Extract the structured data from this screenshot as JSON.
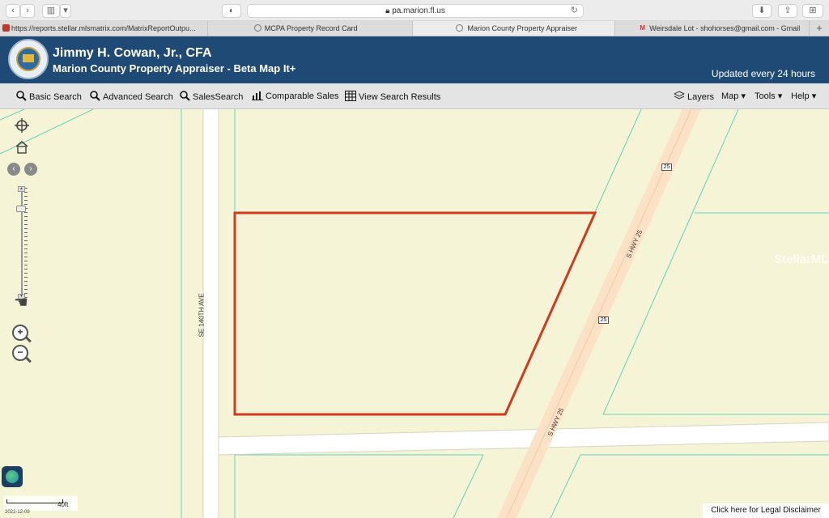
{
  "browser": {
    "url": "pa.marion.fl.us",
    "tabs": [
      {
        "label": "https://reports.stellar.mlsmatrix.com/MatrixReportOutpu..."
      },
      {
        "label": "MCPA Property Record Card"
      },
      {
        "label": "Marion County Property Appraiser"
      },
      {
        "label": "Weirsdale Lot - shohorses@gmail.com - Gmail"
      }
    ]
  },
  "header": {
    "title": "Jimmy H. Cowan, Jr., CFA",
    "subtitle": "Marion County Property Appraiser - Beta Map It+",
    "updated": "Updated every 24 hours"
  },
  "toolbar": {
    "basic_search": "Basic Search",
    "advanced_search": "Advanced Search",
    "sales_search": "SalesSearch",
    "comparable_sales": "Comparable Sales",
    "view_results": "View Search Results",
    "layers": "Layers",
    "map": "Map",
    "tools": "Tools",
    "help": "Help"
  },
  "map": {
    "road_west": "SE 140TH AVE",
    "road_east_1": "S HWY 25",
    "road_east_2": "S HWY 25",
    "shield_1": "25",
    "shield_2": "25",
    "watermark": "StellarMLS",
    "scale_label": "40ft",
    "date": "2022-12-09",
    "disclaimer": "Click here for Legal Disclaimer",
    "colors": {
      "parcel_outline": "#d23a1f",
      "road": "#fbe2c6",
      "header": "#1f4a76",
      "lot_lines": "#5fd3bd"
    }
  }
}
